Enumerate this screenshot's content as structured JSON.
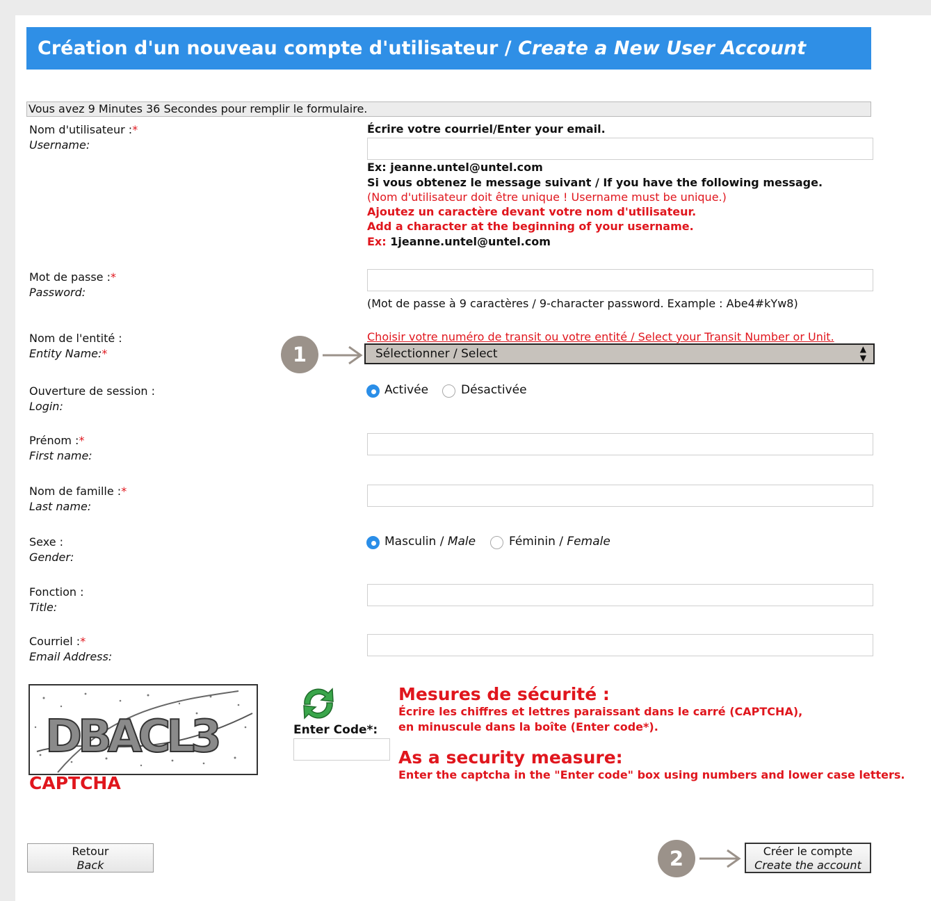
{
  "header": {
    "title_fr": "Création d'un nouveau compte d'utilisateur /",
    "title_en": "Create a New User Account"
  },
  "timer_text": "Vous avez 9 Minutes 36 Secondes pour remplir le formulaire.",
  "required_mark": "*",
  "username": {
    "label_fr": "Nom d'utilisateur :",
    "label_en": "Username:",
    "instruction": "Écrire votre courriel/Enter your email.",
    "value": "",
    "example": "Ex: jeanne.untel@untel.com",
    "note_heading": "Si vous obtenez le message suivant / If you have the following message.",
    "note_error": "(Nom d'utilisateur doit être unique ! Username must be unique.)",
    "note_fr": "Ajoutez un caractère devant votre nom d'utilisateur.",
    "note_en": "Add a character at the beginning of your username.",
    "example2_prefix": "Ex:",
    "example2_value": "1jeanne.untel@untel.com"
  },
  "password": {
    "label_fr": "Mot de passe :",
    "label_en": "Password:",
    "value": "",
    "hint": "(Mot de passe à 9 caractères / 9-character password. Example : Abe4#kYw8)"
  },
  "entity": {
    "label_fr": "Nom de l'entité :",
    "label_en": "Entity Name:",
    "instruction": "Choisir votre numéro de transit ou votre entité / Select your Transit Number or Unit.",
    "selected": "Sélectionner / Select"
  },
  "login": {
    "label_fr": "Ouverture de session :",
    "label_en": "Login:",
    "option_on": "Activée",
    "option_off": "Désactivée",
    "selected": "Activée"
  },
  "firstname": {
    "label_fr": "Prénom :",
    "label_en": "First name:",
    "value": ""
  },
  "lastname": {
    "label_fr": "Nom de famille :",
    "label_en": "Last name:",
    "value": ""
  },
  "gender": {
    "label_fr": "Sexe :",
    "label_en": "Gender:",
    "male_fr": "Masculin /",
    "male_en": "Male",
    "female_fr": "Féminin /",
    "female_en": "Female",
    "selected": "Masculin"
  },
  "title_field": {
    "label_fr": "Fonction :",
    "label_en": "Title:",
    "value": ""
  },
  "email": {
    "label_fr": "Courriel :",
    "label_en": "Email Address:",
    "value": ""
  },
  "captcha": {
    "image_text": "DBACL3",
    "label": "CAPTCHA",
    "enter_code_label": "Enter Code*:",
    "value": ""
  },
  "security": {
    "heading_fr": "Mesures de sécurité :",
    "line1_fr": "Écrire les chiffres et lettres paraissant dans le carré (CAPTCHA),",
    "line2_fr": "en minuscule dans la boîte (Enter code*).",
    "heading_en": "As a security measure:",
    "line_en": "Enter the captcha in the \"Enter code\" box using numbers and lower case letters."
  },
  "buttons": {
    "back_fr": "Retour",
    "back_en": "Back",
    "create_fr": "Créer le compte",
    "create_en": "Create the account"
  },
  "callouts": {
    "one": "1",
    "two": "2"
  },
  "colors": {
    "header_bg": "#2f8fe6",
    "required": "#e0161d",
    "radio_selected": "#2a8ee8",
    "callout": "#9b928a"
  }
}
